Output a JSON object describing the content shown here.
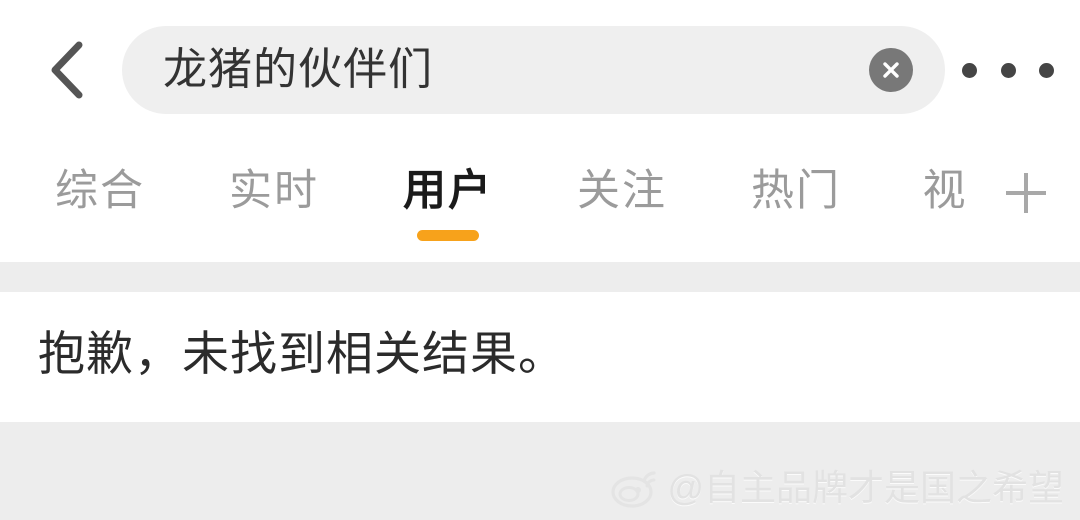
{
  "app": {
    "name": "weibo-search",
    "accent_color": "#f7a21b",
    "background_color": "#ffffff",
    "band_color": "#ededed"
  },
  "topbar": {
    "back_icon": "chevron-left-icon",
    "search": {
      "value": "龙猪的伙伴们",
      "placeholder": "搜索",
      "clear_icon": "close-circle-icon"
    },
    "more_icon": "more-horizontal-icon"
  },
  "tabs": {
    "active_index": 2,
    "items": [
      {
        "label": "综合",
        "active": false
      },
      {
        "label": "实时",
        "active": false
      },
      {
        "label": "用户",
        "active": true
      },
      {
        "label": "关注",
        "active": false
      },
      {
        "label": "热门",
        "active": false
      },
      {
        "label": "视",
        "active": false
      }
    ],
    "add_icon": "plus-icon"
  },
  "result": {
    "empty_message": "抱歉，未找到相关结果。"
  },
  "watermark": {
    "logo_icon": "weibo-eye-icon",
    "handle": "@自主品牌才是国之希望"
  }
}
